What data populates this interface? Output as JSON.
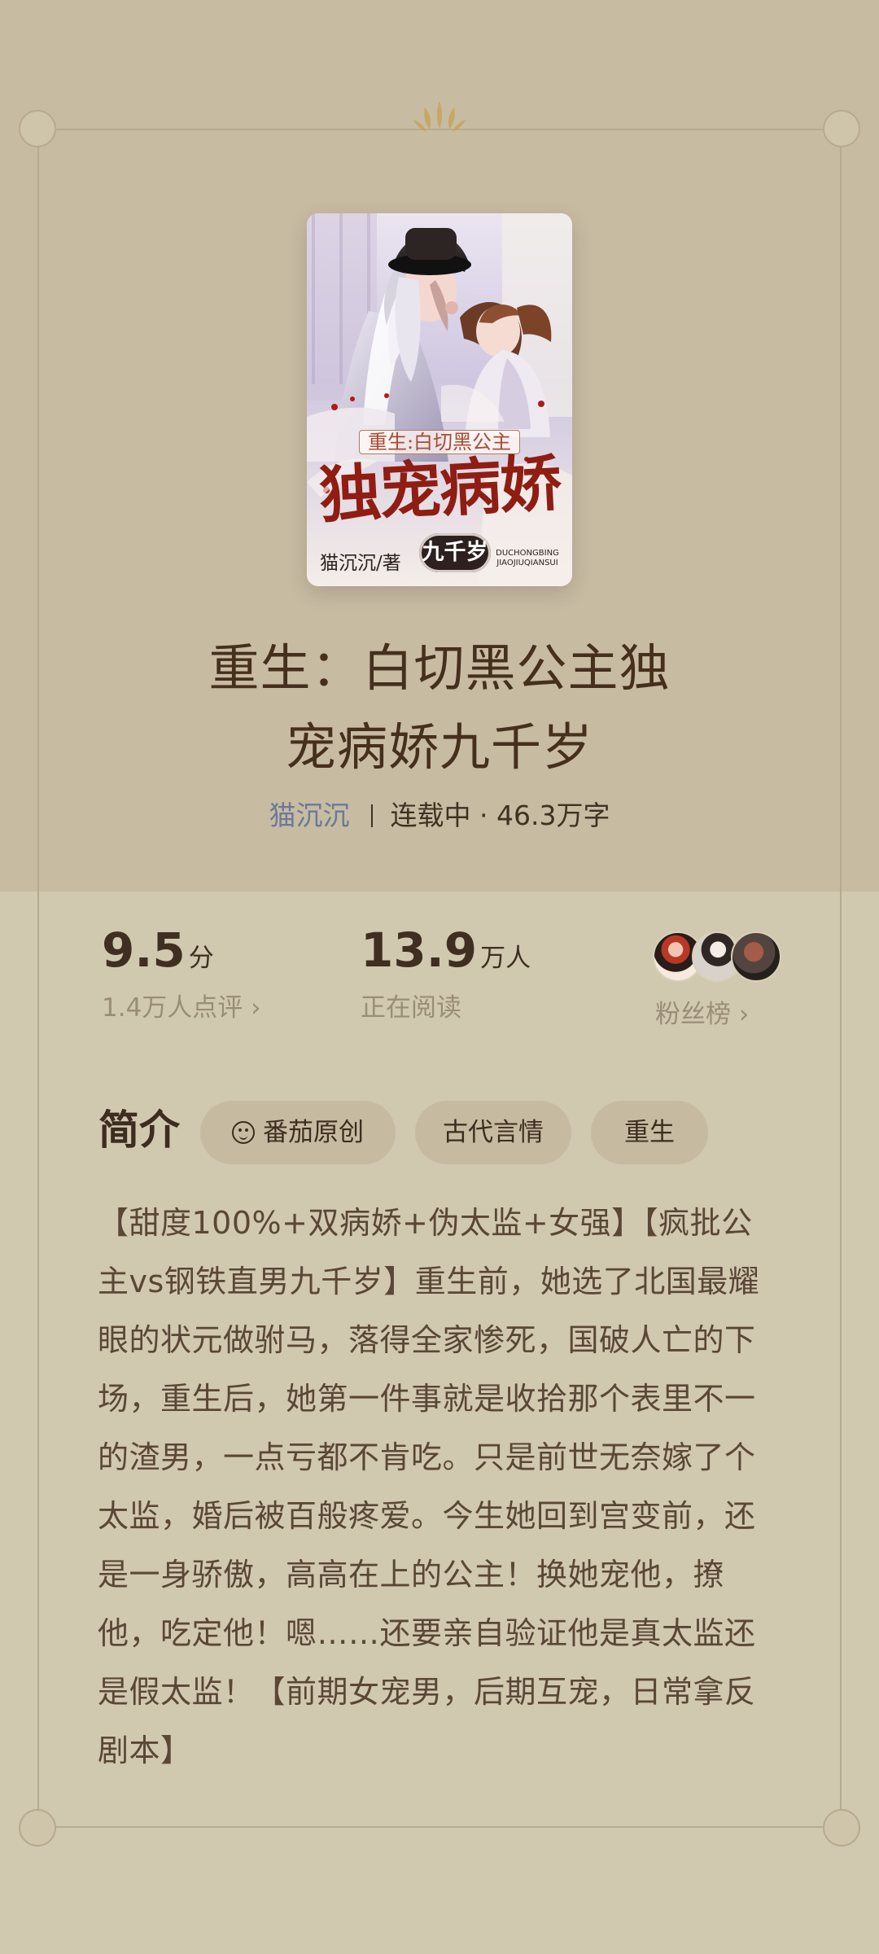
{
  "book": {
    "cover_label_top": "重生:白切黑公主",
    "cover_main_title": "独宠病娇",
    "cover_author": "猫沉沉/著",
    "cover_badge": "九千岁",
    "cover_small_en": "DUCHONGBING JIAOJIUQIANSUI",
    "title_line_1": "重生：白切黑公主独",
    "title_line_2": "宠病娇九千岁",
    "author": "猫沉沉",
    "status": "连载中 · 46.3万字"
  },
  "stats": {
    "rating_value": "9.5",
    "rating_unit": "分",
    "rating_label": "1.4万人点评 ›",
    "reading_value": "13.9",
    "reading_unit": "万人",
    "reading_label": "正在阅读",
    "fans_label": "粉丝榜 ›"
  },
  "intro": {
    "title": "简介",
    "tags": [
      "番茄原创",
      "古代言情",
      "重生"
    ],
    "text": "【甜度100%+双病娇+伪太监+女强】【疯批公主vs钢铁直男九千岁】重生前，她选了北国最耀眼的状元做驸马，落得全家惨死，国破人亡的下场，重生后，她第一件事就是收拾那个表里不一的渣男，一点亏都不肯吃。只是前世无奈嫁了个太监，婚后被百般疼爱。今生她回到宫变前，还是一身骄傲，高高在上的公主！换她宠他，撩他，吃定他！嗯……还要亲自验证他是真太监还是假太监！【前期女宠男，后期互宠，日常拿反剧本】"
  },
  "icons": {
    "ornament": "crown-ornament-icon",
    "tag_original": "tomato-face-icon"
  },
  "colors": {
    "background": "#cfc5ab",
    "top_band": "#c7bba2",
    "frame": "#b7aa8f",
    "title": "#452f1d",
    "author": "#6b7a97",
    "muted": "#9a8d78",
    "tag_bg": "#c6baa0"
  }
}
